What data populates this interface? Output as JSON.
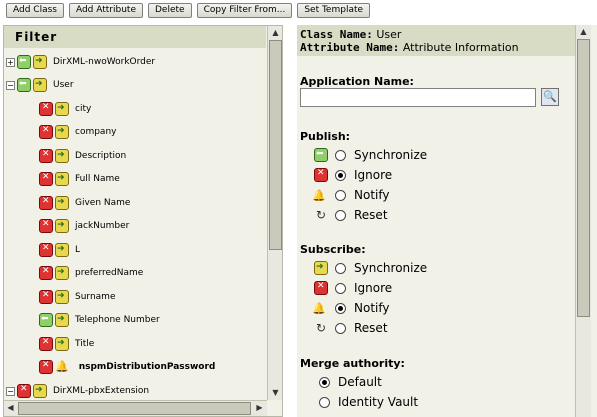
{
  "toolbar": {
    "add_class": "Add Class",
    "add_attribute": "Add Attribute",
    "delete": "Delete",
    "copy_filter": "Copy Filter From...",
    "set_template": "Set Template"
  },
  "filter": {
    "title": "Filter",
    "nodes": [
      {
        "label": "DirXML-nwoWorkOrder",
        "expander": "+",
        "icons": [
          "green",
          "yellow"
        ]
      },
      {
        "label": "User",
        "expander": "−",
        "icons": [
          "green",
          "yellow"
        ]
      },
      {
        "label": "city",
        "icons": [
          "red",
          "yellow"
        ]
      },
      {
        "label": "company",
        "icons": [
          "red",
          "yellow"
        ]
      },
      {
        "label": "Description",
        "icons": [
          "red",
          "yellow"
        ]
      },
      {
        "label": "Full Name",
        "icons": [
          "red",
          "yellow"
        ]
      },
      {
        "label": "Given Name",
        "icons": [
          "red",
          "yellow"
        ]
      },
      {
        "label": "jackNumber",
        "icons": [
          "red",
          "yellow"
        ]
      },
      {
        "label": "L",
        "icons": [
          "red",
          "yellow"
        ]
      },
      {
        "label": "preferredName",
        "icons": [
          "red",
          "yellow"
        ]
      },
      {
        "label": "Surname",
        "icons": [
          "red",
          "yellow"
        ]
      },
      {
        "label": "Telephone Number",
        "icons": [
          "green",
          "yellow"
        ]
      },
      {
        "label": "Title",
        "icons": [
          "red",
          "yellow"
        ]
      },
      {
        "label": "nspmDistributionPassword",
        "icons": [
          "red",
          "bell"
        ]
      },
      {
        "label": "DirXML-pbxExtension",
        "expander": "−",
        "icons": [
          "red",
          "yellow"
        ]
      }
    ]
  },
  "details": {
    "class_name_label": "Class Name:",
    "class_name_value": "User",
    "attribute_name_label": "Attribute Name:",
    "attribute_name_value": "Attribute Information",
    "application_name_label": "Application Name:",
    "application_name_value": "",
    "publish_label": "Publish:",
    "publish_options": [
      "Synchronize",
      "Ignore",
      "Notify",
      "Reset"
    ],
    "publish_selected": "Ignore",
    "subscribe_label": "Subscribe:",
    "subscribe_options": [
      "Synchronize",
      "Ignore",
      "Notify",
      "Reset"
    ],
    "subscribe_selected": "Notify",
    "merge_label": "Merge authority:",
    "merge_options": [
      "Default",
      "Identity Vault"
    ],
    "merge_selected": "Default"
  },
  "colors": {
    "header_bg": "#d9dcc4",
    "pane_bg": "#f1f1e8"
  }
}
